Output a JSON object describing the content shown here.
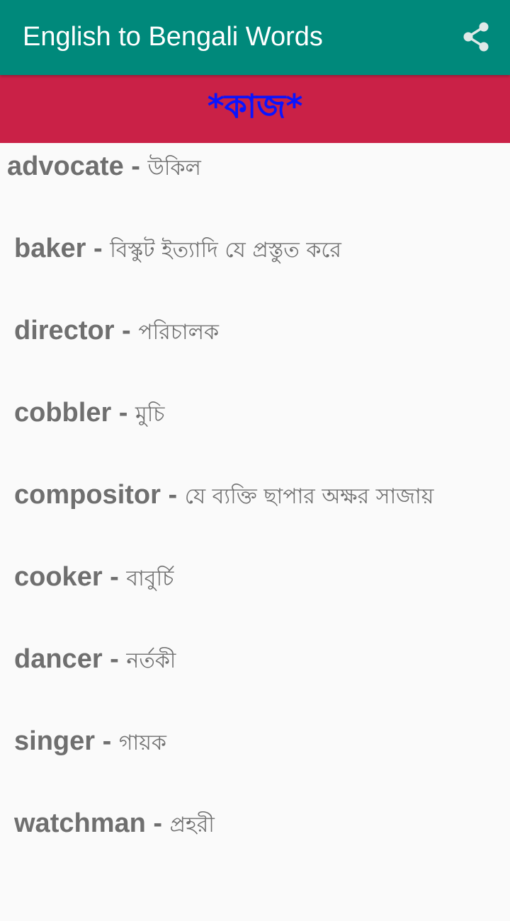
{
  "app_bar": {
    "title": "English to Bengali Words",
    "share_icon": "share-icon",
    "background": "#00897b"
  },
  "category": {
    "title": "*কাজ*",
    "background": "#ca2147",
    "text_color": "#0a14ff"
  },
  "words": [
    {
      "en": "advocate",
      "sep": " - ",
      "bn": "উকিল"
    },
    {
      "en": "baker",
      "sep": " - ",
      "bn": "বিস্কুট ইত্যাদি যে প্রস্তুত করে"
    },
    {
      "en": "director",
      "sep": " - ",
      "bn": "পরিচালক"
    },
    {
      "en": "cobbler",
      "sep": " - ",
      "bn": "মুচি"
    },
    {
      "en": "compositor",
      "sep": " - ",
      "bn": "যে ব্যক্তি ছাপার অক্ষর সাজায়"
    },
    {
      "en": "cooker",
      "sep": " - ",
      "bn": "বাবুর্চি"
    },
    {
      "en": "dancer",
      "sep": " - ",
      "bn": "নর্তকী"
    },
    {
      "en": "singer",
      "sep": " - ",
      "bn": "গায়ক"
    },
    {
      "en": "watchman",
      "sep": " - ",
      "bn": "প্রহরী"
    }
  ]
}
